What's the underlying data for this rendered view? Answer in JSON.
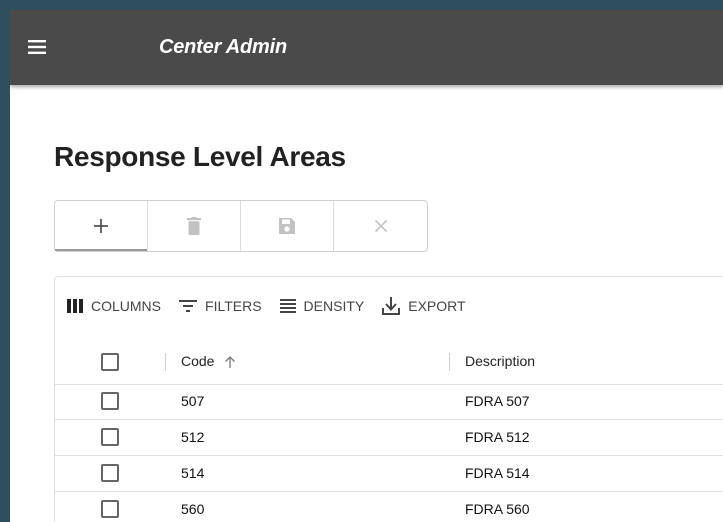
{
  "app": {
    "title": "Center Admin"
  },
  "page": {
    "title": "Response Level Areas"
  },
  "toolbar": {
    "buttons": [
      {
        "icon": "plus-icon",
        "active": true
      },
      {
        "icon": "trash-icon",
        "active": false
      },
      {
        "icon": "save-icon",
        "active": false
      },
      {
        "icon": "close-icon",
        "active": false
      }
    ]
  },
  "grid": {
    "toolbar": {
      "columns": "COLUMNS",
      "filters": "FILTERS",
      "density": "DENSITY",
      "export": "EXPORT"
    },
    "headers": {
      "code": "Code",
      "description": "Description"
    },
    "rows": [
      {
        "code": "507",
        "description": "FDRA 507"
      },
      {
        "code": "512",
        "description": "FDRA 512"
      },
      {
        "code": "514",
        "description": "FDRA 514"
      },
      {
        "code": "560",
        "description": "FDRA 560"
      }
    ]
  },
  "colors": {
    "topbar": "#4a4a4a",
    "background": "#2f4f5c",
    "icon_disabled": "#c2c2c2"
  }
}
